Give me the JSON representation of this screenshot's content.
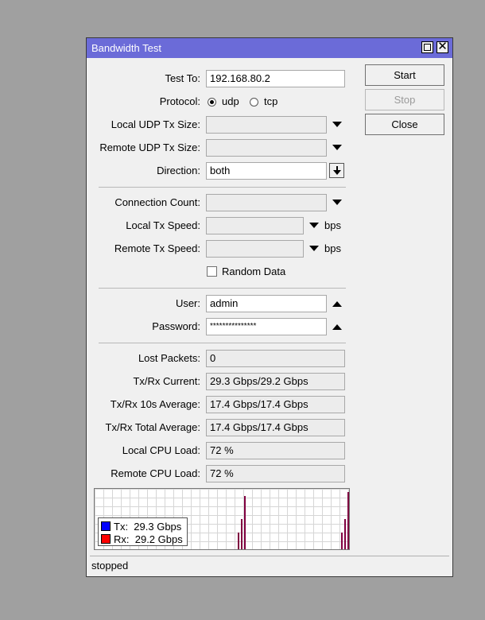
{
  "window": {
    "title": "Bandwidth Test"
  },
  "buttons": {
    "start": "Start",
    "stop": "Stop",
    "close": "Close"
  },
  "form": {
    "test_to": {
      "label": "Test To:",
      "value": "192.168.80.2"
    },
    "protocol": {
      "label": "Protocol:",
      "options": [
        "udp",
        "tcp"
      ],
      "selected": "udp"
    },
    "local_udp_tx_size": {
      "label": "Local UDP Tx Size:",
      "value": ""
    },
    "remote_udp_tx_size": {
      "label": "Remote UDP Tx Size:",
      "value": ""
    },
    "direction": {
      "label": "Direction:",
      "value": "both"
    },
    "connection_count": {
      "label": "Connection Count:",
      "value": ""
    },
    "local_tx_speed": {
      "label": "Local Tx Speed:",
      "value": "",
      "unit": "bps"
    },
    "remote_tx_speed": {
      "label": "Remote Tx Speed:",
      "value": "",
      "unit": "bps"
    },
    "random_data": {
      "label": "Random Data",
      "checked": false
    },
    "user": {
      "label": "User:",
      "value": "admin"
    },
    "password": {
      "label": "Password:",
      "value": "***************"
    }
  },
  "results": {
    "lost_packets": {
      "label": "Lost Packets:",
      "value": "0"
    },
    "txrx_current": {
      "label": "Tx/Rx Current:",
      "value": "29.3 Gbps/29.2 Gbps"
    },
    "txrx_10s_avg": {
      "label": "Tx/Rx 10s Average:",
      "value": "17.4 Gbps/17.4 Gbps"
    },
    "txrx_total_avg": {
      "label": "Tx/Rx Total Average:",
      "value": "17.4 Gbps/17.4 Gbps"
    },
    "local_cpu": {
      "label": "Local CPU Load:",
      "value": "72 %"
    },
    "remote_cpu": {
      "label": "Remote CPU Load:",
      "value": "72 %"
    }
  },
  "graph": {
    "legend": [
      {
        "key": "Tx:",
        "value": "29.3 Gbps",
        "color": "#0000ff"
      },
      {
        "key": "Rx:",
        "value": "29.2 Gbps",
        "color": "#ff0000"
      }
    ]
  },
  "chart_data": {
    "type": "bar",
    "series": [
      {
        "name": "Tx",
        "values": [
          0.28,
          0.5,
          0.88,
          0.28,
          0.5,
          0.95
        ]
      },
      {
        "name": "Rx",
        "values": [
          0.28,
          0.5,
          0.88,
          0.28,
          0.5,
          0.95
        ]
      }
    ]
  },
  "status": {
    "text": "stopped"
  },
  "colors": {
    "titlebar": "#6b6bd8",
    "tx": "#0000ff",
    "rx": "#ff0000",
    "bar": "#800040"
  }
}
